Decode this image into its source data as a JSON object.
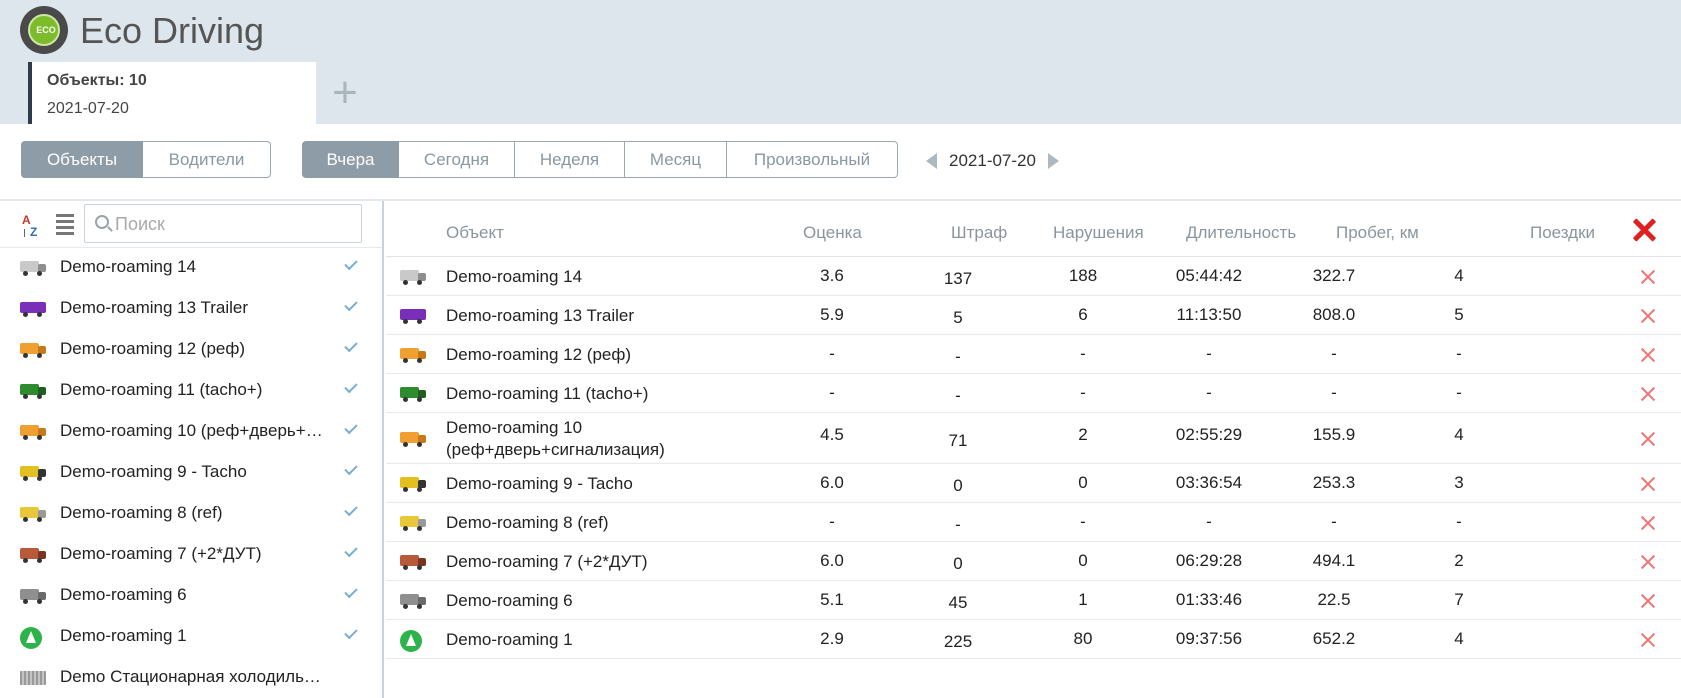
{
  "app": {
    "title": "Eco Driving",
    "logo_text": "ECO"
  },
  "tabs": {
    "active": {
      "title": "Объекты: 10",
      "date": "2021-07-20"
    },
    "add_symbol": "+"
  },
  "mode_buttons": [
    {
      "label": "Объекты",
      "active": true
    },
    {
      "label": "Водители",
      "active": false
    }
  ],
  "period_buttons": [
    {
      "label": "Вчера",
      "active": true
    },
    {
      "label": "Сегодня",
      "active": false
    },
    {
      "label": "Неделя",
      "active": false
    },
    {
      "label": "Месяц",
      "active": false
    },
    {
      "label": "Произвольный",
      "active": false
    }
  ],
  "date_nav": {
    "date": "2021-07-20"
  },
  "sidebar": {
    "sort_az": {
      "a": "A",
      "z": "Z"
    },
    "search": {
      "placeholder": "Поиск",
      "value": ""
    },
    "items": [
      {
        "name": "Demo-roaming 14",
        "icon": "gray-truck-icon",
        "checked": true
      },
      {
        "name": "Demo-roaming 13 Trailer",
        "icon": "purple-trailer-icon",
        "checked": true
      },
      {
        "name": "Demo-roaming 12 (реф)",
        "icon": "orange-truck-icon",
        "checked": true
      },
      {
        "name": "Demo-roaming 11 (tacho+)",
        "icon": "green-truck-icon",
        "checked": true
      },
      {
        "name": "Demo-roaming 10 (реф+дверь+…",
        "icon": "orange-truck-icon",
        "checked": true
      },
      {
        "name": "Demo-roaming 9 - Tacho",
        "icon": "yellow-truck-icon",
        "checked": true
      },
      {
        "name": "Demo-roaming 8 (ref)",
        "icon": "yellow-van-icon",
        "checked": true
      },
      {
        "name": "Demo-roaming 7 (+2*ДУТ)",
        "icon": "red-car-icon",
        "checked": true
      },
      {
        "name": "Demo-roaming 6",
        "icon": "gray-van-icon",
        "checked": true
      },
      {
        "name": "Demo-roaming 1",
        "icon": "green-arrow-icon",
        "checked": true
      },
      {
        "name": "Demo Стационарная холодиль…",
        "icon": "container-icon",
        "checked": false
      }
    ]
  },
  "table": {
    "headers": {
      "object": "Объект",
      "score": "Оценка",
      "penalty": "Штраф",
      "violations": "Нарушения",
      "duration": "Длительность",
      "mileage": "Пробег, км",
      "trips": "Поездки"
    },
    "rows": [
      {
        "icon": "gray-truck-icon",
        "object": "Demo-roaming 14",
        "object2": "",
        "score": "3.6",
        "penalty": "137",
        "violations": "188",
        "duration": "05:44:42",
        "mileage": "322.7",
        "trips": "4"
      },
      {
        "icon": "purple-trailer-icon",
        "object": "Demo-roaming 13 Trailer",
        "object2": "",
        "score": "5.9",
        "penalty": "5",
        "violations": "6",
        "duration": "11:13:50",
        "mileage": "808.0",
        "trips": "5"
      },
      {
        "icon": "orange-truck-icon",
        "object": "Demo-roaming 12 (реф)",
        "object2": "",
        "score": "-",
        "penalty": "-",
        "violations": "-",
        "duration": "-",
        "mileage": "-",
        "trips": "-"
      },
      {
        "icon": "green-truck-icon",
        "object": "Demo-roaming 11 (tacho+)",
        "object2": "",
        "score": "-",
        "penalty": "-",
        "violations": "-",
        "duration": "-",
        "mileage": "-",
        "trips": "-"
      },
      {
        "icon": "orange-truck-icon",
        "object": "Demo-roaming 10",
        "object2": "(реф+дверь+сигнализация)",
        "score": "4.5",
        "penalty": "71",
        "violations": "2",
        "duration": "02:55:29",
        "mileage": "155.9",
        "trips": "4"
      },
      {
        "icon": "yellow-truck-icon",
        "object": "Demo-roaming 9 - Tacho",
        "object2": "",
        "score": "6.0",
        "penalty": "0",
        "violations": "0",
        "duration": "03:36:54",
        "mileage": "253.3",
        "trips": "3"
      },
      {
        "icon": "yellow-van-icon",
        "object": "Demo-roaming 8 (ref)",
        "object2": "",
        "score": "-",
        "penalty": "-",
        "violations": "-",
        "duration": "-",
        "mileage": "-",
        "trips": "-"
      },
      {
        "icon": "red-car-icon",
        "object": "Demo-roaming 7 (+2*ДУТ)",
        "object2": "",
        "score": "6.0",
        "penalty": "0",
        "violations": "0",
        "duration": "06:29:28",
        "mileage": "494.1",
        "trips": "2"
      },
      {
        "icon": "gray-van-icon",
        "object": "Demo-roaming 6",
        "object2": "",
        "score": "5.1",
        "penalty": "45",
        "violations": "1",
        "duration": "01:33:46",
        "mileage": "22.5",
        "trips": "7"
      },
      {
        "icon": "green-arrow-icon",
        "object": "Demo-roaming 1",
        "object2": "",
        "score": "2.9",
        "penalty": "225",
        "violations": "80",
        "duration": "09:37:56",
        "mileage": "652.2",
        "trips": "4"
      }
    ]
  },
  "colors": {
    "header_bg": "#dde6ec",
    "active_button": "#8d9ca6",
    "delete_red": "#e02020",
    "check_blue": "#7aaed0"
  }
}
